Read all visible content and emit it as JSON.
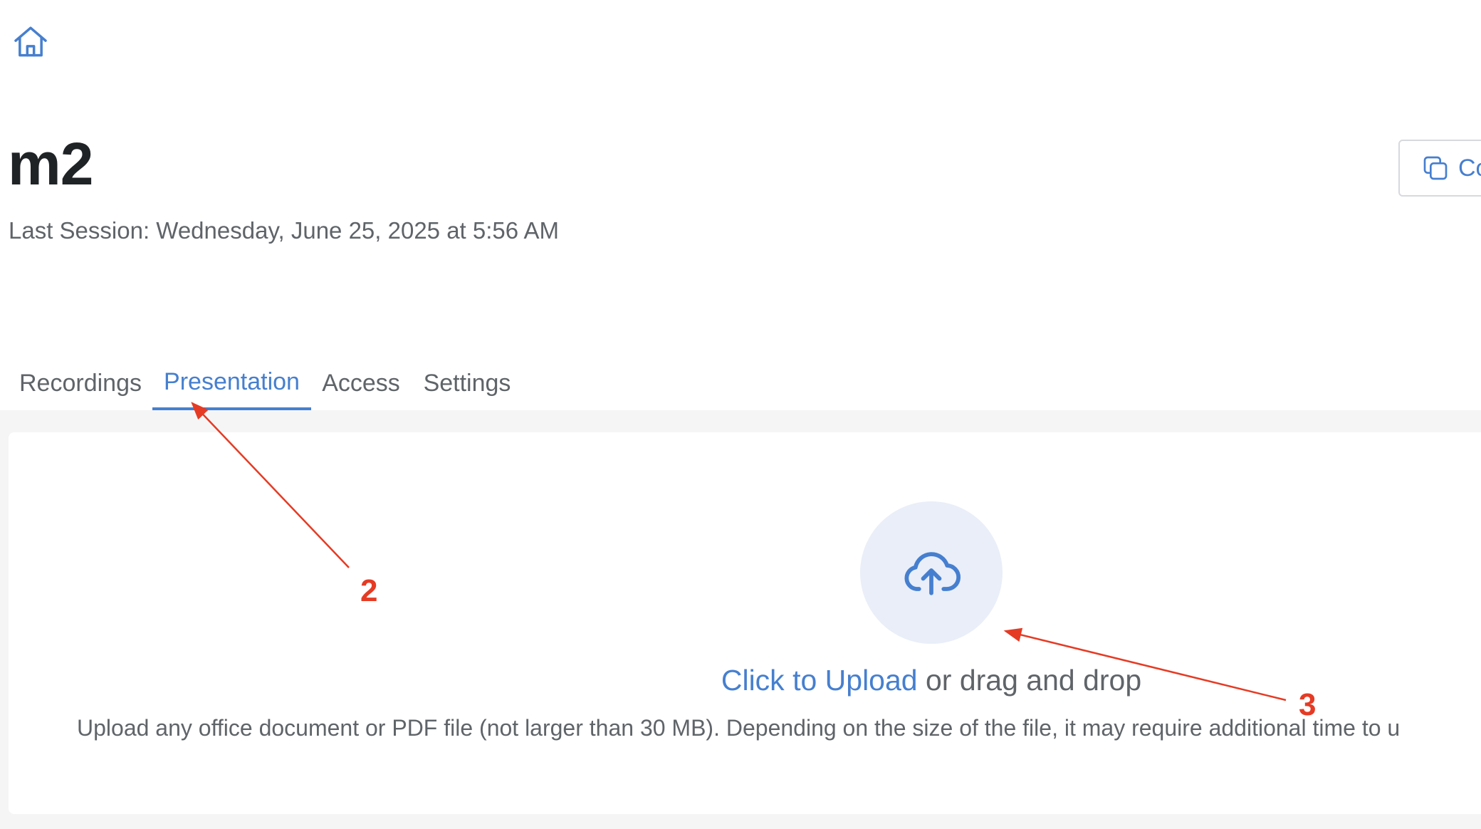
{
  "header": {
    "home_icon": "home-icon",
    "room_title": "m2",
    "last_session": "Last Session: Wednesday, June 25, 2025 at 5:56 AM",
    "copy_button": {
      "icon": "copy-icon",
      "label": "Co"
    }
  },
  "tabs": [
    {
      "label": "Recordings",
      "active": false
    },
    {
      "label": "Presentation",
      "active": true
    },
    {
      "label": "Access",
      "active": false
    },
    {
      "label": "Settings",
      "active": false
    }
  ],
  "upload": {
    "icon": "cloud-upload-icon",
    "link_text": "Click to Upload",
    "rest_text": " or drag and drop",
    "hint": "Upload any office document or PDF file (not larger than 30 MB). Depending on the size of the file, it may require additional time to u"
  },
  "annotations": {
    "marker_2": "2",
    "marker_3": "3",
    "color": "#e53b24"
  },
  "colors": {
    "accent": "#467fcf",
    "text_muted": "#5f6469",
    "content_bg": "#f5f5f6",
    "upload_circle_bg": "#e9eef8"
  }
}
